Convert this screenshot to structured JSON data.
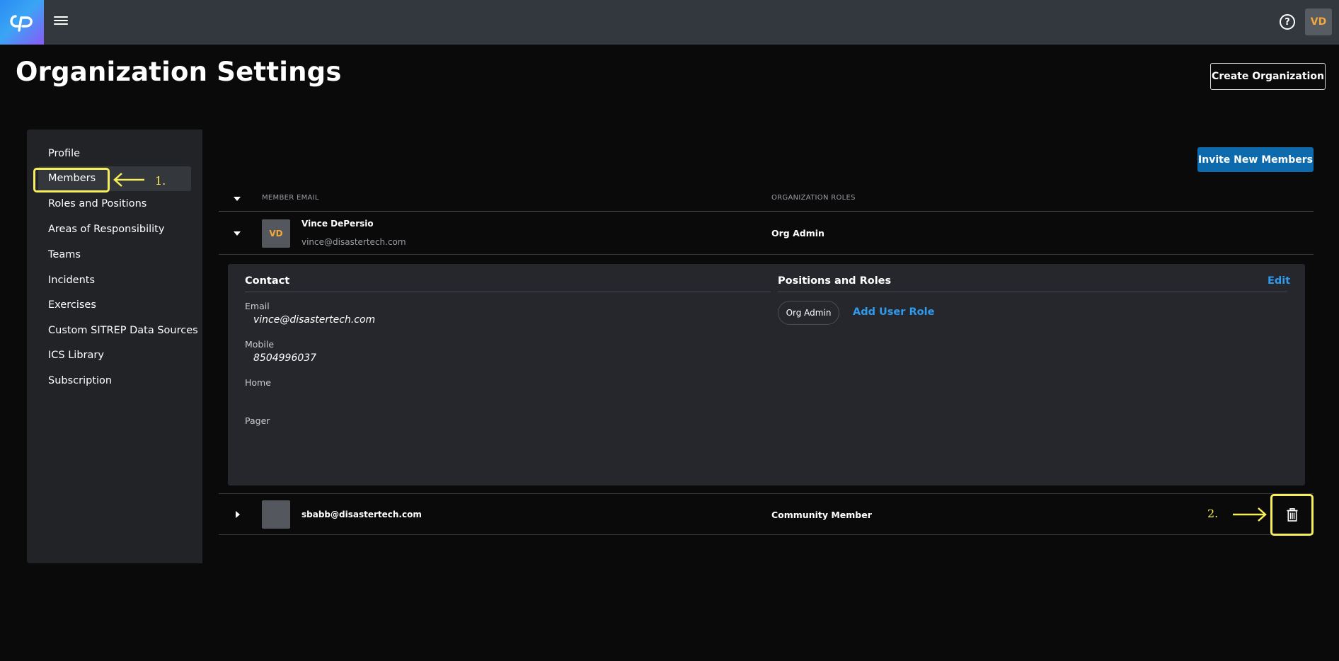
{
  "header": {
    "menu_icon": "hamburger-menu-icon",
    "help_icon_glyph": "?",
    "user_initials": "VD"
  },
  "page": {
    "title": "Organization Settings",
    "create_button": "Create Organization"
  },
  "sidebar": {
    "items": [
      {
        "label": "Profile"
      },
      {
        "label": "Members",
        "active": true
      },
      {
        "label": "Roles and Positions"
      },
      {
        "label": "Areas of Responsibility"
      },
      {
        "label": "Teams"
      },
      {
        "label": "Incidents"
      },
      {
        "label": "Exercises"
      },
      {
        "label": "Custom SITREP Data Sources"
      },
      {
        "label": "ICS Library"
      },
      {
        "label": "Subscription"
      }
    ]
  },
  "members": {
    "invite_button": "Invite New Members",
    "columns": [
      "MEMBER EMAIL",
      "ORGANIZATION ROLES"
    ],
    "rows": [
      {
        "initials": "VD",
        "name": "Vince DePersio",
        "email": "vince@disastertech.com",
        "role": "Org Admin",
        "expanded": true
      },
      {
        "initials": "",
        "name": "sbabb@disastertech.com",
        "email": "",
        "role": "Community Member",
        "expanded": false
      }
    ]
  },
  "detail": {
    "contact_heading": "Contact",
    "email_label": "Email",
    "email_value": "vince@disastertech.com",
    "mobile_label": "Mobile",
    "mobile_value": "8504996037",
    "home_label": "Home",
    "pager_label": "Pager",
    "positions_heading": "Positions and Roles",
    "edit_label": "Edit",
    "role_chip": "Org Admin",
    "add_role_label": "Add User Role"
  },
  "annotations": {
    "step1": "1.",
    "step2": "2."
  },
  "colors": {
    "accent_blue": "#0d6aad",
    "link_blue": "#2e9bef",
    "annotation_yellow": "#f6ee5b",
    "avatar_orange": "#f2a83b"
  }
}
